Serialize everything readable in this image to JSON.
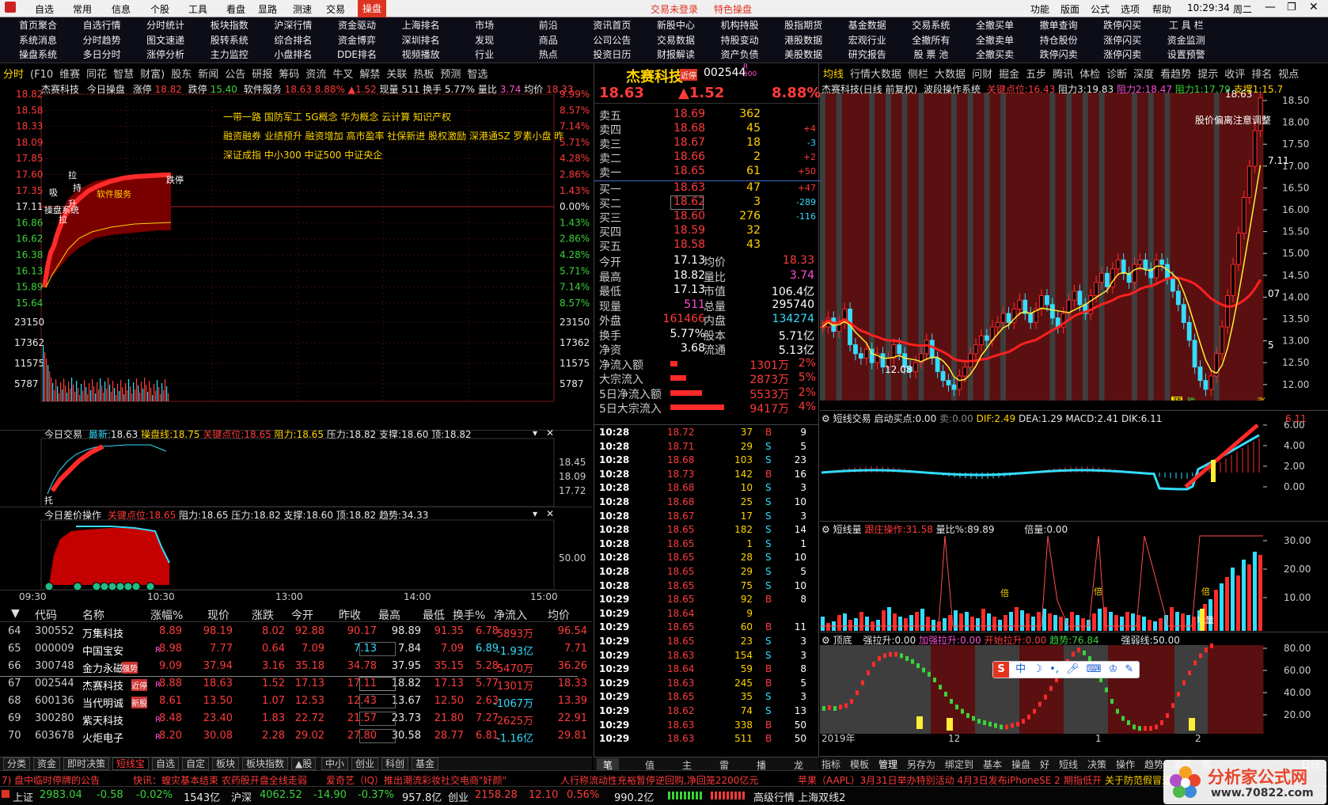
{
  "menu": {
    "items": [
      "自选",
      "常用",
      "信息",
      "个股",
      "工具",
      "看盘",
      "显路",
      "测速",
      "交易"
    ],
    "active": "操盘",
    "login": "交易未登录",
    "special": "特色操盘",
    "right": [
      "功能",
      "版面",
      "公式",
      "选项",
      "帮助"
    ],
    "clock": "10:29:34",
    "weekday": "周二"
  },
  "nav": [
    [
      "首页聚合",
      "自选行情",
      "分时统计",
      "板块指数",
      "沪深行情",
      "资金驱动",
      "上海排名",
      "市场",
      "前沿",
      "资讯首页",
      "新股中心",
      "机构持股",
      "股指期货",
      "基金数据",
      "交易系统",
      "全撤买单",
      "撤单查询",
      "跌停闪买",
      "工 具 栏"
    ],
    [
      "系统消息",
      "分时趋势",
      "图文速递",
      "股转系统",
      "综合排名",
      "资金博弈",
      "深圳排名",
      "发现",
      "商品",
      "公司公告",
      "交易数据",
      "持股变动",
      "港股数据",
      "宏观行业",
      "全撤所有",
      "全撤卖单",
      "持仓股份",
      "涨停闪买",
      "资金监测"
    ],
    [
      "操盘系统",
      "多日分时",
      "涨停分析",
      "主力监控",
      "小盘排名",
      "DDE排名",
      "视频播放",
      "行业",
      "热点",
      "投资日历",
      "财报解读",
      "资产负债",
      "美股数据",
      "研究报告",
      "股 票 池",
      "全撤买卖",
      "跌停闪卖",
      "涨停闪卖",
      "设置预警"
    ]
  ],
  "left_tabs": [
    "分时",
    "(F10",
    "维赛",
    "同花",
    "智慧",
    "财富)",
    "股东",
    "新闻",
    "公告",
    "研报",
    "筹码",
    "资流",
    "牛叉",
    "解禁",
    "关联",
    "热板",
    "预测",
    "智选"
  ],
  "intraday": {
    "stock": "杰赛科技",
    "title": "今日操盘",
    "zt": "涨停",
    "zt_val": "18.82",
    "dt": "跌停",
    "dt_val": "15.40",
    "sector": "软件服务",
    "sector_price": "18.63",
    "sector_pct": "8.88%",
    "sector_chg": "▲1.52",
    "vol": "现量 511",
    "turnover": "换手 5.77%",
    "ratio_lbl": "量比",
    "ratio": "3.74",
    "avg_lbl": "均价",
    "avg": "18.33",
    "price_ticks": [
      "18.82",
      "18.58",
      "18.33",
      "18.09",
      "17.85",
      "17.60",
      "17.35",
      "17.11",
      "16.86",
      "16.62",
      "16.38",
      "16.13",
      "15.89",
      "15.64"
    ],
    "pct_ticks": [
      "9.99%",
      "8.57%",
      "7.14%",
      "5.71%",
      "4.28%",
      "2.86%",
      "1.43%",
      "0.00%",
      "1.43%",
      "2.86%",
      "4.28%",
      "5.71%",
      "7.14%",
      "8.57%"
    ],
    "vol_ticks": [
      "23150",
      "17362",
      "11575",
      "5787"
    ],
    "concepts": [
      "一带一路 国防军工 5G概念 华为概念 云计算 知识产权",
      "融资融券 业绩预升 融资增加 高市盈率 社保新进 股权激励 深港通SZ 罗素小盘 昨",
      "深证成指 中小300 中证500 中证央企"
    ],
    "labels": [
      "操盘系统",
      "吸",
      "拉",
      "升",
      "持",
      "拉",
      "跌停",
      "软件服务"
    ],
    "sub1": {
      "title": "今日交易",
      "last_lbl": "最新:",
      "last": "18.63",
      "line_lbl": "操盘线:",
      "line": "18.75",
      "key_lbl": "关键点位:",
      "key": "18.65",
      "res_lbl": "阻力:",
      "res": "18.65",
      "pres_lbl": "压力:",
      "pres": "18.82",
      "sup_lbl": "支撑:",
      "sup": "18.60",
      "top_lbl": "顶:",
      "top": "18.82",
      "ticks": [
        "18.45",
        "18.09",
        "17.72"
      ],
      "mark": "托"
    },
    "sub2": {
      "title": "今日差价操作",
      "key_lbl": "关键点位:",
      "key": "18.65",
      "res_lbl": "阻力:",
      "res": "18.65",
      "pres_lbl": "压力:",
      "pres": "18.82",
      "sup_lbl": "支撑:",
      "sup": "18.60",
      "top_lbl": "顶:",
      "top": "18.82",
      "trend_lbl": "趋势:",
      "trend": "34.33",
      "tick": "50.00"
    },
    "times": [
      "09:30",
      "10:30",
      "13:00",
      "14:00",
      "15:00"
    ]
  },
  "table": {
    "headers": [
      "代码",
      "名称",
      "涨幅%",
      "现价",
      "涨跌",
      "今开",
      "昨收",
      "最高",
      "最低",
      "换手%",
      "净流入",
      "均价"
    ],
    "rows": [
      [
        "64",
        "300552",
        "万集科技",
        "",
        "8.89",
        "98.19",
        "8.02",
        "92.88",
        "90.17",
        "98.89",
        "91.35",
        "6.78",
        "5893万",
        "96.54"
      ],
      [
        "65",
        "000009",
        "中国宝安",
        "R",
        "8.98",
        "7.77",
        "0.64",
        "7.09",
        "7.13",
        "7.84",
        "7.09",
        "6.89",
        "-1.93亿",
        "7.71"
      ],
      [
        "66",
        "300748",
        "金力永磁",
        "",
        "9.09",
        "37.94",
        "3.16",
        "35.18",
        "34.78",
        "37.95",
        "35.15",
        "5.28",
        "5470万",
        "36.26"
      ],
      [
        "67",
        "002544",
        "杰赛科技",
        "R",
        "8.88",
        "18.63",
        "1.52",
        "17.13",
        "17.11",
        "18.82",
        "17.13",
        "5.77",
        "1301万",
        "18.33"
      ],
      [
        "68",
        "600136",
        "当代明诚",
        "",
        "8.61",
        "13.50",
        "1.07",
        "12.53",
        "12.43",
        "13.67",
        "12.50",
        "2.63",
        "-1067万",
        "13.39"
      ],
      [
        "69",
        "300280",
        "紫天科技",
        "R",
        "8.48",
        "23.40",
        "1.83",
        "22.72",
        "21.57",
        "23.73",
        "21.80",
        "7.27",
        "2625万",
        "22.91"
      ],
      [
        "70",
        "603678",
        "火炬电子",
        "R",
        "8.20",
        "30.08",
        "2.28",
        "29.02",
        "27.80",
        "30.58",
        "28.77",
        "6.81",
        "-1.16亿",
        "29.81"
      ]
    ],
    "badges": {
      "r2": "强势",
      "r3": "近停",
      "r4": "新股"
    }
  },
  "bottom_tabs": [
    "分类",
    "资金",
    "即时决策",
    "短线宝",
    "自选",
    "自定",
    "板块",
    "板块指数",
    "▲股",
    "中小",
    "创业",
    "科创",
    "基金"
  ],
  "bottom_tabs_active": "短线宝",
  "quote": {
    "name": "杰赛科技",
    "code": "002544",
    "tag": "近停",
    "tag2": "R 500",
    "price": "18.63",
    "chg": "▲1.52",
    "pct": "8.88%",
    "asks": [
      [
        "卖五",
        "18.69",
        "362",
        ""
      ],
      [
        "卖四",
        "18.68",
        "45",
        "+4"
      ],
      [
        "卖三",
        "18.67",
        "18",
        "-3"
      ],
      [
        "卖二",
        "18.66",
        "2",
        "+2"
      ],
      [
        "卖一",
        "18.65",
        "61",
        "+50"
      ]
    ],
    "bids": [
      [
        "买一",
        "18.63",
        "47",
        "+47"
      ],
      [
        "买二",
        "18.62",
        "3",
        "-289"
      ],
      [
        "买三",
        "18.60",
        "276",
        "-116"
      ],
      [
        "买四",
        "18.59",
        "32",
        ""
      ],
      [
        "买五",
        "18.58",
        "43",
        ""
      ]
    ],
    "stats": [
      [
        "今开",
        "17.13",
        "均价",
        "18.33"
      ],
      [
        "最高",
        "18.82",
        "量比",
        "3.74"
      ],
      [
        "最低",
        "17.13",
        "市值",
        "106.4亿"
      ],
      [
        "现量",
        "511",
        "总量",
        "295740"
      ],
      [
        "外盘",
        "161466",
        "内盘",
        "134274"
      ],
      [
        "换手",
        "5.77%",
        "股本",
        "5.71亿"
      ],
      [
        "净资",
        "3.68",
        "流通",
        "5.13亿"
      ]
    ],
    "flows": [
      [
        "净流入额",
        "1301万",
        "2%",
        0.1
      ],
      [
        "大宗流入",
        "2873万",
        "5%",
        0.24
      ],
      [
        "5日净流入额",
        "5533万",
        "2%",
        0.47
      ],
      [
        "5日大宗流入",
        "9417万",
        "4%",
        0.8
      ]
    ],
    "ticks": [
      [
        "10:28",
        "18.72",
        "37",
        "B",
        "9"
      ],
      [
        "10:28",
        "18.71",
        "29",
        "S",
        "5"
      ],
      [
        "10:28",
        "18.68",
        "103",
        "S",
        "23"
      ],
      [
        "10:28",
        "18.73",
        "142",
        "B",
        "16"
      ],
      [
        "10:28",
        "18.68",
        "10",
        "S",
        "3"
      ],
      [
        "10:28",
        "18.68",
        "25",
        "S",
        "10"
      ],
      [
        "10:28",
        "18.67",
        "17",
        "S",
        "3"
      ],
      [
        "10:28",
        "18.65",
        "182",
        "S",
        "14"
      ],
      [
        "10:28",
        "18.65",
        "1",
        "S",
        "1"
      ],
      [
        "10:28",
        "18.65",
        "28",
        "S",
        "10"
      ],
      [
        "10:28",
        "18.65",
        "29",
        "S",
        "5"
      ],
      [
        "10:28",
        "18.65",
        "75",
        "S",
        "10"
      ],
      [
        "10:29",
        "18.65",
        "92",
        "B",
        "8"
      ],
      [
        "10:29",
        "18.64",
        "9",
        "",
        ""
      ],
      [
        "10:29",
        "18.65",
        "60",
        "B",
        "11"
      ],
      [
        "10:29",
        "18.65",
        "23",
        "S",
        "3"
      ],
      [
        "10:29",
        "18.63",
        "154",
        "S",
        "3"
      ],
      [
        "10:29",
        "18.64",
        "59",
        "B",
        "8"
      ],
      [
        "10:29",
        "18.63",
        "245",
        "B",
        "5"
      ],
      [
        "10:29",
        "18.65",
        "35",
        "S",
        "3"
      ],
      [
        "10:29",
        "18.62",
        "74",
        "S",
        "13"
      ],
      [
        "10:29",
        "18.63",
        "338",
        "B",
        "50"
      ],
      [
        "10:29",
        "18.63",
        "511",
        "B",
        "50"
      ]
    ],
    "foot_tabs": [
      "笔",
      "值",
      "主",
      "雷",
      "播",
      "龙"
    ]
  },
  "kline": {
    "tabs": [
      "均线",
      "行情大数据",
      "侧栏",
      "大数据",
      "问财",
      "掘金",
      "五步",
      "腾讯",
      "体检",
      "诊断",
      "深度",
      "看趋势",
      "提示",
      "收评",
      "排名",
      "视点"
    ],
    "title": "杰赛科技(日线 前复权)",
    "system": "波段操作系统",
    "key_lbl": "关键点位:",
    "key": "16.43",
    "r3_lbl": "阻力3:",
    "r3": "19.83",
    "r2_lbl": "阻力2:",
    "r2": "18.47",
    "r1_lbl": "阻力1:",
    "r1": "17.79",
    "s1_lbl": "支撑1:",
    "s1": "15.7",
    "note": "股价偏离注意调整",
    "hi_label": "18.63",
    "lo_label": "12.08",
    "ticks": [
      "18.50",
      "18.00",
      "17.50",
      "17.00",
      "16.50",
      "16.00",
      "15.50",
      "15.00",
      "14.50",
      "14.00",
      "13.50",
      "13.00",
      "12.50",
      "12.00"
    ],
    "edge_labels": [
      "7.11",
      "07",
      "5"
    ],
    "bottom_tags": [
      "预",
      "跌",
      "涨"
    ],
    "closes": [
      13.5,
      13.7,
      13.4,
      13.6,
      13.9,
      13.1,
      12.9,
      12.8,
      13.0,
      12.7,
      12.9,
      12.6,
      12.8,
      13.1,
      12.9,
      12.6,
      12.5,
      12.7,
      12.9,
      13.2,
      12.8,
      12.5,
      12.3,
      12.2,
      12.1,
      12.4,
      12.6,
      12.9,
      13.1,
      13.3,
      13.2,
      13.5,
      13.6,
      13.8,
      13.6,
      13.9,
      14.1,
      13.8,
      13.6,
      13.9,
      14.2,
      14.0,
      13.7,
      13.5,
      13.8,
      14.1,
      14.3,
      14.0,
      13.8,
      14.2,
      14.5,
      14.7,
      14.4,
      14.8,
      15.0,
      14.7,
      14.5,
      14.9,
      15.0,
      14.8,
      14.6,
      15.0,
      14.9,
      14.6,
      14.3,
      14.0,
      13.6,
      13.2,
      12.6,
      12.3,
      12.1,
      12.4,
      12.9,
      13.5,
      14.2,
      14.9,
      15.6,
      16.4,
      17.1,
      17.9,
      18.63
    ]
  },
  "macd": {
    "title": "短线交易",
    "start_lbl": "启动买点:",
    "start": "0.00",
    "sell_lbl": "卖:",
    "sell": "0.00",
    "dif_lbl": "DIF:",
    "dif": "2.49",
    "dea_lbl": "DEA:",
    "dea": "1.29",
    "macd_lbl": "MACD:",
    "macd": "2.41",
    "dik_lbl": "DIK:",
    "dik": "6.11",
    "tail": "6.11",
    "ticks": [
      "6.00",
      "4.00",
      "2.00",
      "0.00"
    ]
  },
  "volume": {
    "title": "短线量",
    "follow_lbl": "跟庄操作:",
    "follow": "31.58",
    "ratio_lbl": "量比%:",
    "ratio": "89.89",
    "bei_lbl": "倍量:",
    "bei": "0.00",
    "ticks": [
      "30.00",
      "20.00",
      "10.00"
    ],
    "labels": [
      "倍",
      "倍",
      "倍",
      "地量"
    ]
  },
  "topbottom": {
    "title": "顶底",
    "qls_lbl": "强拉升:",
    "qls": "0.00",
    "jqls_lbl": "加强拉升:",
    "jqls": "0.00",
    "ksls_lbl": "开始拉升:",
    "ksls": "0.00",
    "trend_lbl": "趋势:",
    "trend": "76.84",
    "strong_lbl": "强弱线:",
    "strong": "50.00",
    "ticks": [
      "80.00",
      "60.00",
      "40.00",
      "20.00"
    ],
    "years": [
      "2019年",
      "12",
      "1",
      "2"
    ]
  },
  "ime": {
    "logo": "S",
    "text": "中"
  },
  "kfoot": [
    "指标",
    "模板",
    "管理",
    "另存为",
    "绑定到",
    "基本",
    "操盘",
    "好",
    "短线",
    "决策",
    "操作",
    "趋势",
    "波段",
    "周"
  ],
  "kfoot_right": "日线",
  "ticker": [
    "7) 盘中临时停牌的公告",
    "快讯：蝗灾基本结束 农药股开盘全线走弱",
    "爱奇艺（IQ）推出潮流彩妆社交电商\"奸颜\"",
    "人行称流动性充裕暂停逆回购,净回笼2200亿元",
    "苹果（AAPL）3月31日举办特别活动 4月3日发布iPhoneSE 2",
    "期指低开",
    "关于防范假冒道"
  ],
  "status": {
    "sh_lbl": "上证",
    "sh": "2983.04",
    "sh_chg": "-0.58",
    "sh_pct": "-0.02%",
    "sh_amt": "1543亿",
    "sz_lbl": "沪深",
    "sz": "4062.52",
    "sz_chg": "-14.90",
    "sz_pct": "-0.37%",
    "sz_amt": "957.8亿",
    "cy_lbl": "创业",
    "cy": "2158.28",
    "cy_chg": "12.10",
    "cy_pct": "0.56%",
    "cy_amt": "990.2亿",
    "feed": "高级行情 上海双线2"
  },
  "watermark": {
    "cn": "分析家公式网",
    "url": "www.70822.com"
  },
  "colors": {
    "up": "#ff3b3b",
    "down": "#33ddff",
    "flat": "#e8e8e8",
    "accent": "#ffd400",
    "kline_bg": "#5a1010"
  }
}
